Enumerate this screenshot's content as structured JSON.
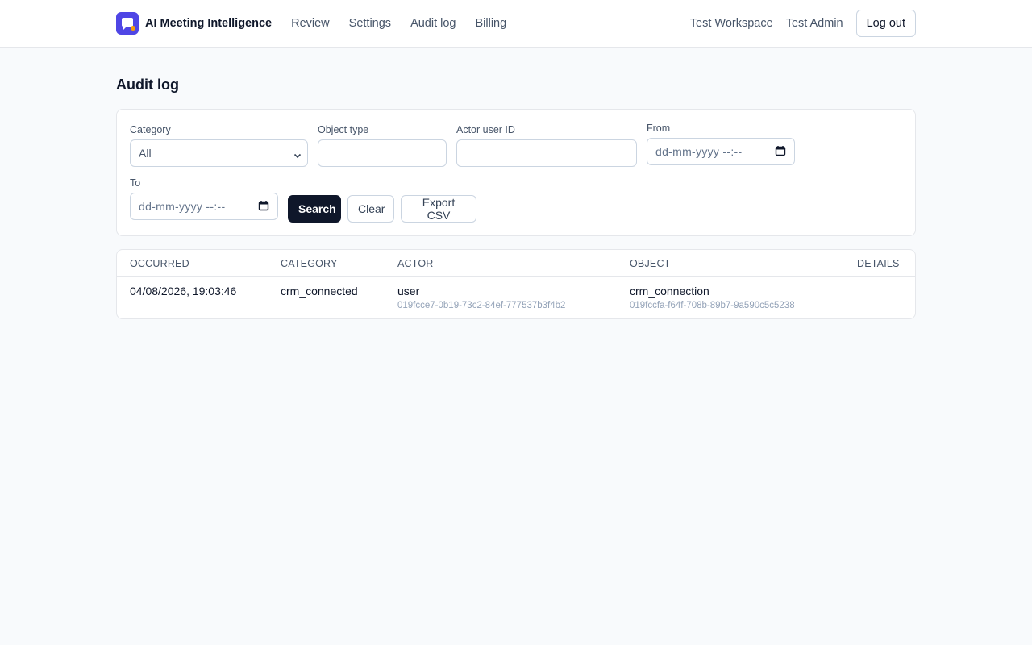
{
  "header": {
    "brand": "AI Meeting Intelligence",
    "nav": [
      "Review",
      "Settings",
      "Audit log",
      "Billing"
    ],
    "workspace": "Test Workspace",
    "user": "Test Admin",
    "logout": "Log out"
  },
  "page": {
    "title": "Audit log"
  },
  "filters": {
    "category_label": "Category",
    "category_value": "All",
    "object_type_label": "Object type",
    "object_type_value": "",
    "actor_label": "Actor user ID",
    "actor_value": "",
    "from_label": "From",
    "from_placeholder": "dd-mm-yyyy  --:--",
    "to_label": "To",
    "to_placeholder": "dd-mm-yyyy  --:--",
    "search": "Search",
    "clear": "Clear",
    "export": "Export CSV"
  },
  "table": {
    "columns": [
      "Occurred",
      "Category",
      "Actor",
      "Object",
      "Details"
    ],
    "rows": [
      {
        "occurred": "04/08/2026, 19:03:46",
        "category": "crm_connected",
        "actor_type": "user",
        "actor_id": "019fcce7-0b19-73c2-84ef-777537b3f4b2",
        "object_type": "crm_connection",
        "object_id": "019fccfa-f64f-708b-89b7-9a590c5c5238",
        "details": ""
      }
    ]
  },
  "colors": {
    "brand": "#4f46e5",
    "brand_dot": "#f59e0b",
    "primary_button": "#0f172a"
  }
}
